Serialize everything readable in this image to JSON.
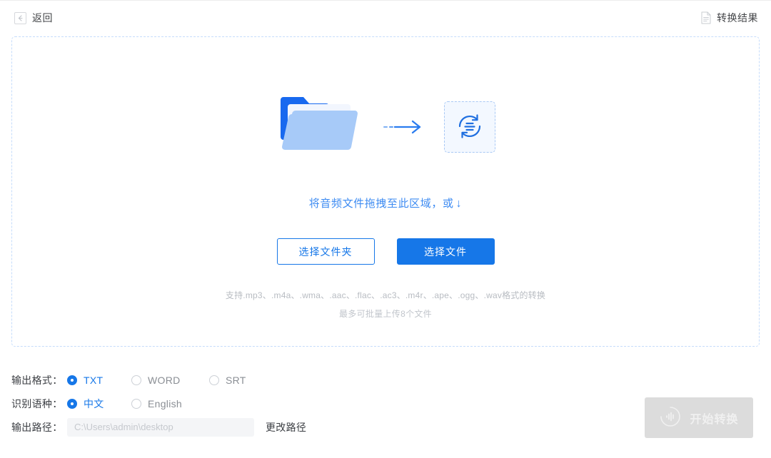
{
  "header": {
    "back_label": "返回",
    "back_icon": "arrow-left-icon",
    "result_label": "转换结果",
    "result_icon": "document-icon"
  },
  "dropzone": {
    "folder_icon": "folder-open-icon",
    "arrow_icon": "arrow-right-icon",
    "convert_icon": "convert-refresh-icon",
    "drop_text": "将音频文件拖拽至此区域，或",
    "drop_arrow": "↓",
    "select_folder_button": "选择文件夹",
    "select_file_button": "选择文件",
    "supported_formats": "支持.mp3、.m4a、.wma、.aac、.flac、.ac3、.m4r、.ape、.ogg、.wav格式的转换",
    "batch_limit": "最多可批量上传8个文件"
  },
  "settings": {
    "output_format": {
      "label": "输出格式：",
      "options": [
        {
          "label": "TXT",
          "selected": true
        },
        {
          "label": "WORD",
          "selected": false
        },
        {
          "label": "SRT",
          "selected": false
        }
      ]
    },
    "language": {
      "label": "识别语种：",
      "options": [
        {
          "label": "中文",
          "selected": true
        },
        {
          "label": "English",
          "selected": false
        }
      ]
    },
    "output_path": {
      "label": "输出路径：",
      "value": "",
      "placeholder": "C:\\Users\\admin\\desktop",
      "change_link": "更改路径"
    }
  },
  "action": {
    "start_label": "开始转换",
    "start_icon": "audio-wave-circle-icon",
    "disabled": true
  },
  "colors": {
    "accent": "#1677e8",
    "link_blue": "#3d8bf2",
    "muted": "#b8bcc2",
    "disabled_bg": "#dcdcdc"
  }
}
